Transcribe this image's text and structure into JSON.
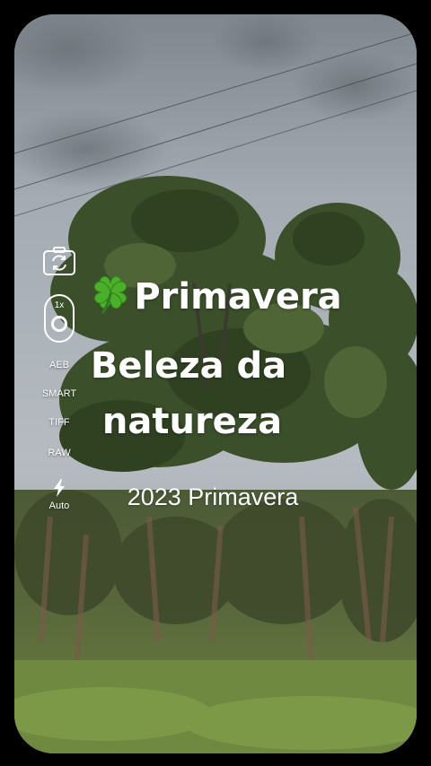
{
  "overlay": {
    "title_line1": "Primavera",
    "title_line2": "Beleza da",
    "title_line3": "natureza",
    "subtitle": "2023 Primavera",
    "title_icon": "four-leaf-clover-icon"
  },
  "camera_controls": {
    "switch_camera_icon": "camera-switch-icon",
    "zoom_label": "1x",
    "modes": [
      "AEB",
      "SMART",
      "TIFF",
      "RAW"
    ],
    "flash_icon": "flash-icon",
    "flash_label": "Auto"
  },
  "colors": {
    "background": "#000000",
    "text": "#ffffff",
    "clover": "#4caf2a"
  }
}
